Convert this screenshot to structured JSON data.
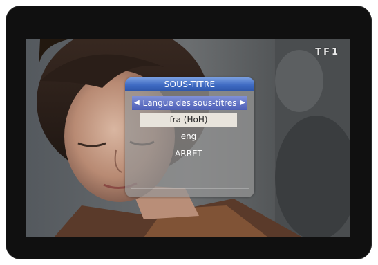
{
  "screen": {
    "channel_logo": "TF1"
  },
  "subtitle_menu": {
    "title": "SOUS-TITRE",
    "header_label": "Langue des sous-titres",
    "options": [
      {
        "label": "fra (HoH)",
        "selected": true
      },
      {
        "label": "eng",
        "selected": false
      },
      {
        "label": "ARRET",
        "selected": false
      }
    ]
  },
  "colors": {
    "title_bar": "#3f6bc3",
    "header_bar": "#5a6bc0",
    "selected_option_bg": "#e8e4dc"
  },
  "icons": {
    "left": "arrow-left-icon",
    "right": "arrow-right-icon"
  }
}
